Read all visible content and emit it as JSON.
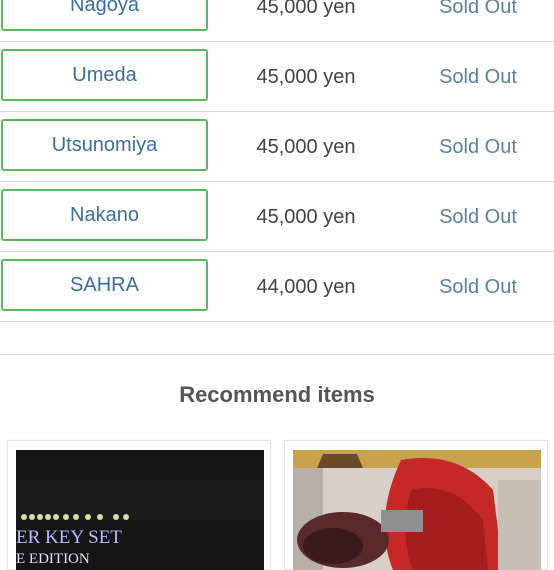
{
  "stock_rows": [
    {
      "store": "Nagoya",
      "price": "45,000 yen",
      "status": "Sold Out"
    },
    {
      "store": "Umeda",
      "price": "45,000 yen",
      "status": "Sold Out"
    },
    {
      "store": "Utsunomiya",
      "price": "45,000 yen",
      "status": "Sold Out"
    },
    {
      "store": "Nakano",
      "price": "45,000 yen",
      "status": "Sold Out"
    },
    {
      "store": "SAHRA",
      "price": "44,000 yen",
      "status": "Sold Out"
    }
  ],
  "recommend": {
    "title": "Recommend items",
    "items": [
      {
        "image_text_1": "ER KEY SET",
        "image_text_2": "E EDITION"
      },
      {
        "image_text_1": ""
      }
    ]
  },
  "colors": {
    "button_border": "#5cb85c",
    "store_text": "#3b6ea5",
    "status_text": "#5b7fa6"
  }
}
